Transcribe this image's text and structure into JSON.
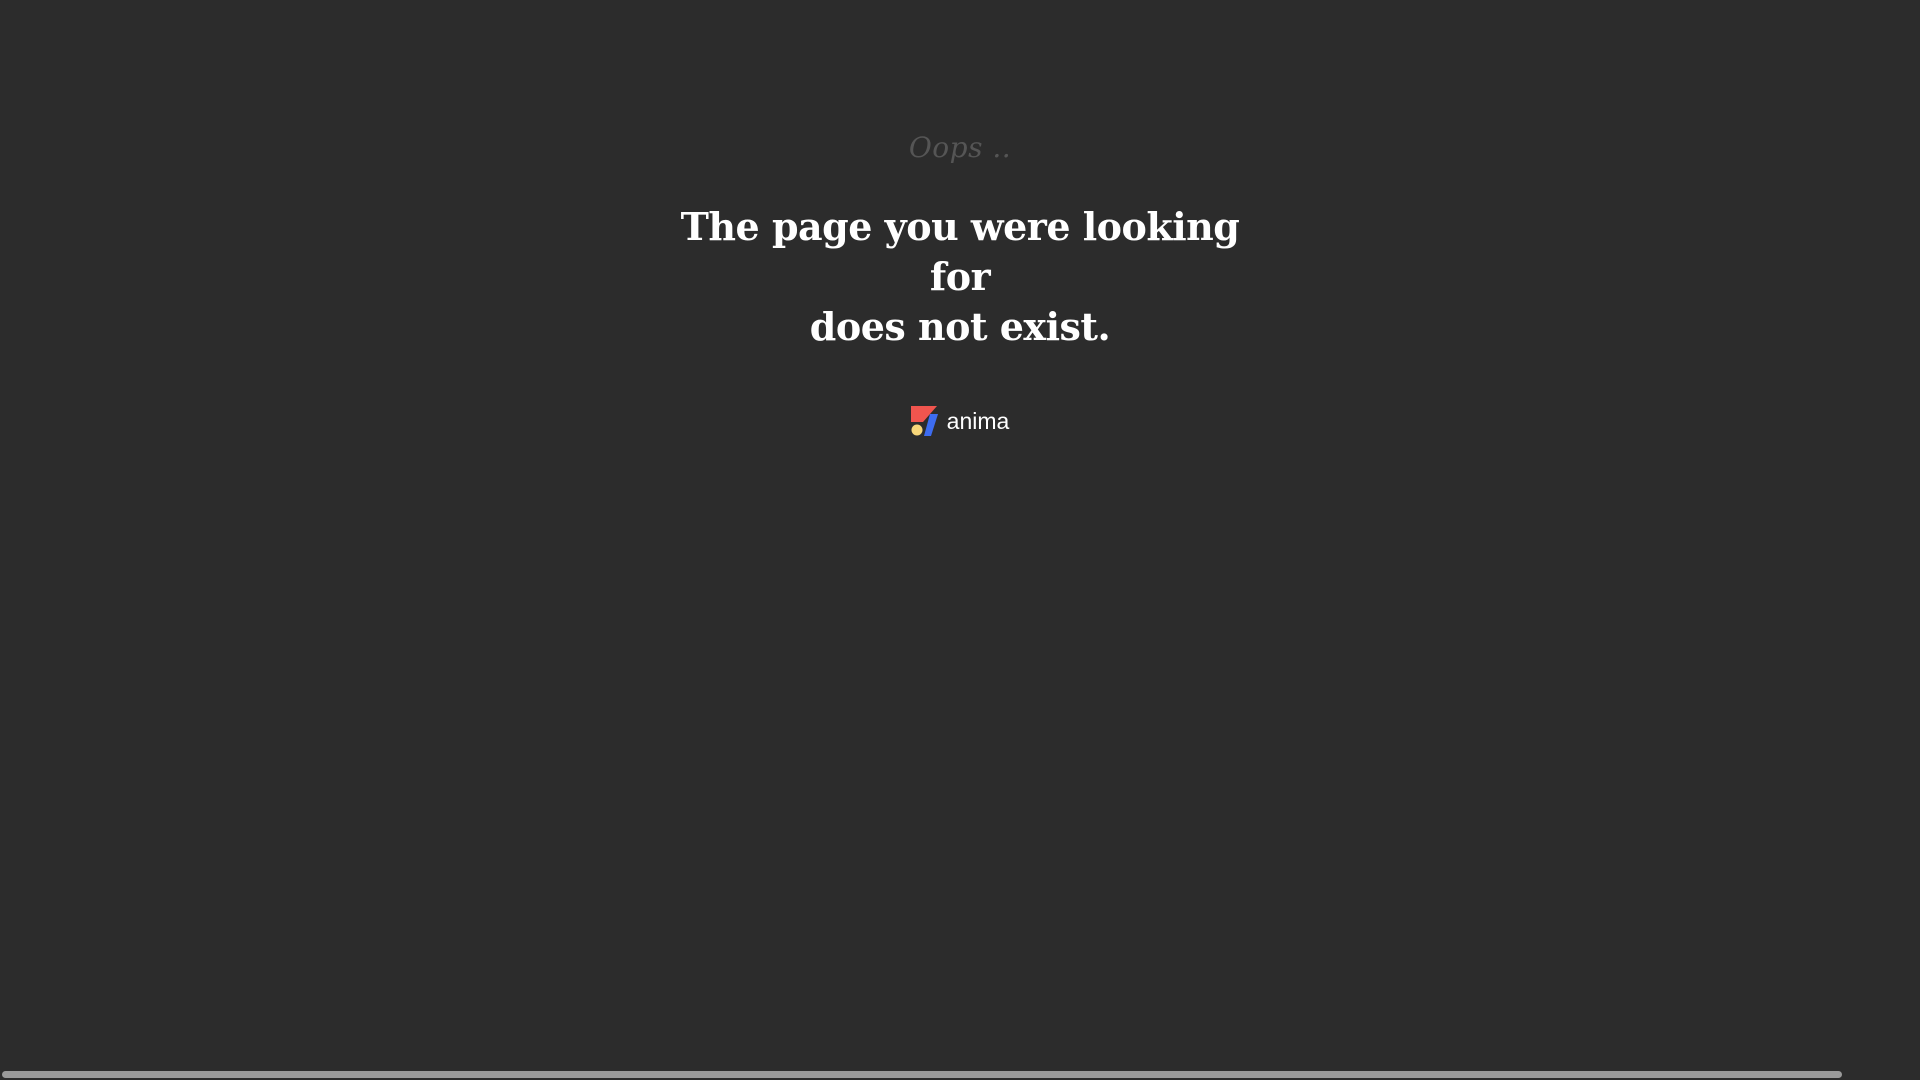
{
  "error": {
    "oops": "Oops ..",
    "line1": "The page you were looking for",
    "line2": "does not exist."
  },
  "brand": {
    "name": "anima",
    "logo_icon": "anima-logo-icon",
    "colors": {
      "red": "#f0554e",
      "yellow": "#f7d77a",
      "blue": "#3d6cf0"
    }
  },
  "theme": {
    "background": "#2c2c2c",
    "text": "#ffffff",
    "muted": "#555555",
    "scrollbar": "#9a9a9a"
  }
}
